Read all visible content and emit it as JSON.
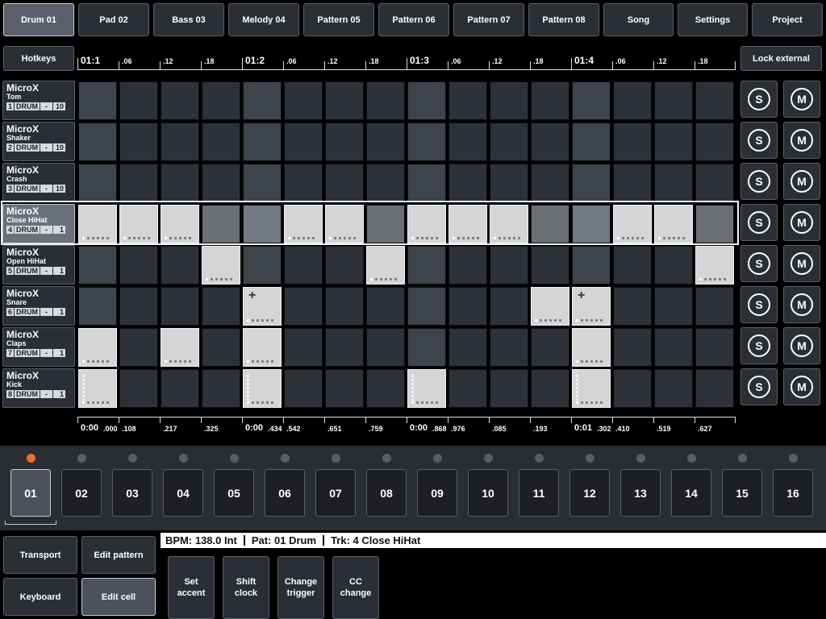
{
  "tabs": [
    {
      "label": "Drum 01",
      "active": true
    },
    {
      "label": "Pad 02",
      "active": false
    },
    {
      "label": "Bass 03",
      "active": false
    },
    {
      "label": "Melody 04",
      "active": false
    },
    {
      "label": "Pattern 05",
      "active": false
    },
    {
      "label": "Pattern 06",
      "active": false
    },
    {
      "label": "Pattern 07",
      "active": false
    },
    {
      "label": "Pattern 08",
      "active": false
    },
    {
      "label": "Song",
      "active": false
    },
    {
      "label": "Settings",
      "active": false
    },
    {
      "label": "Project",
      "active": false
    }
  ],
  "hotkeys_label": "Hotkeys",
  "lock_external_label": "Lock external",
  "ruler_top": [
    "01:1",
    ".06",
    ".12",
    ".18",
    "01:2",
    ".06",
    ".12",
    ".18",
    "01:3",
    ".06",
    ".12",
    ".18",
    "01:4",
    ".06",
    ".12",
    ".18"
  ],
  "ruler_bottom": [
    {
      "main": "0:00",
      "sub": ".000"
    },
    {
      "main": "",
      "sub": ".108"
    },
    {
      "main": "",
      "sub": ".217"
    },
    {
      "main": "",
      "sub": ".325"
    },
    {
      "main": "0:00",
      "sub": ".434"
    },
    {
      "main": "",
      "sub": ".542"
    },
    {
      "main": "",
      "sub": ".651"
    },
    {
      "main": "",
      "sub": ".759"
    },
    {
      "main": "0:00",
      "sub": ".868"
    },
    {
      "main": "",
      "sub": ".976"
    },
    {
      "main": "",
      "sub": ".085"
    },
    {
      "main": "",
      "sub": ".193"
    },
    {
      "main": "0:01",
      "sub": ".302"
    },
    {
      "main": "",
      "sub": ".410"
    },
    {
      "main": "",
      "sub": ".519"
    },
    {
      "main": "",
      "sub": ".627"
    }
  ],
  "tracks": [
    {
      "name": "MicroX",
      "instrument": "Tom",
      "num": "1",
      "type": "DRUM",
      "mode": "-",
      "note": "10",
      "selected": false,
      "cells": [
        0,
        0,
        0,
        0,
        0,
        0,
        0,
        0,
        0,
        0,
        0,
        0,
        0,
        0,
        0,
        0
      ]
    },
    {
      "name": "MicroX",
      "instrument": "Shaker",
      "num": "2",
      "type": "DRUM",
      "mode": "-",
      "note": "10",
      "selected": false,
      "cells": [
        0,
        0,
        0,
        0,
        0,
        0,
        0,
        0,
        0,
        0,
        0,
        0,
        0,
        0,
        0,
        0
      ]
    },
    {
      "name": "MicroX",
      "instrument": "Crash",
      "num": "3",
      "type": "DRUM",
      "mode": "-",
      "note": "10",
      "selected": false,
      "cells": [
        0,
        0,
        0,
        0,
        0,
        0,
        0,
        0,
        0,
        0,
        0,
        0,
        0,
        0,
        0,
        0
      ]
    },
    {
      "name": "MicroX",
      "instrument": "Close HiHat",
      "num": "4",
      "type": "DRUM",
      "mode": "-",
      "note": "1",
      "selected": true,
      "cells": [
        1,
        1,
        1,
        2,
        2,
        1,
        1,
        2,
        1,
        1,
        1,
        2,
        2,
        1,
        1,
        2
      ]
    },
    {
      "name": "MicroX",
      "instrument": "Open HiHat",
      "num": "5",
      "type": "DRUM",
      "mode": "-",
      "note": "1",
      "selected": false,
      "cells": [
        0,
        0,
        0,
        1,
        0,
        0,
        0,
        1,
        0,
        0,
        0,
        0,
        0,
        0,
        0,
        1
      ]
    },
    {
      "name": "MicroX",
      "instrument": "Snare",
      "num": "6",
      "type": "DRUM",
      "mode": "-",
      "note": "1",
      "selected": false,
      "cells": [
        0,
        0,
        0,
        0,
        3,
        0,
        0,
        0,
        0,
        0,
        0,
        1,
        3,
        0,
        0,
        0
      ]
    },
    {
      "name": "MicroX",
      "instrument": "Claps",
      "num": "7",
      "type": "DRUM",
      "mode": "-",
      "note": "1",
      "selected": false,
      "cells": [
        1,
        0,
        1,
        0,
        1,
        0,
        0,
        0,
        0,
        0,
        0,
        0,
        1,
        0,
        0,
        0
      ]
    },
    {
      "name": "MicroX",
      "instrument": "Kick",
      "num": "8",
      "type": "DRUM",
      "mode": "-",
      "note": "1",
      "selected": false,
      "cells": [
        4,
        0,
        0,
        0,
        4,
        0,
        0,
        0,
        4,
        0,
        0,
        0,
        4,
        0,
        0,
        0
      ]
    }
  ],
  "solo_label": "S",
  "mute_label": "M",
  "steps": [
    {
      "label": "01",
      "playing": true,
      "active": true
    },
    {
      "label": "02",
      "playing": false,
      "active": false
    },
    {
      "label": "03",
      "playing": false,
      "active": false
    },
    {
      "label": "04",
      "playing": false,
      "active": false
    },
    {
      "label": "05",
      "playing": false,
      "active": false
    },
    {
      "label": "06",
      "playing": false,
      "active": false
    },
    {
      "label": "07",
      "playing": false,
      "active": false
    },
    {
      "label": "08",
      "playing": false,
      "active": false
    },
    {
      "label": "09",
      "playing": false,
      "active": false
    },
    {
      "label": "10",
      "playing": false,
      "active": false
    },
    {
      "label": "11",
      "playing": false,
      "active": false
    },
    {
      "label": "12",
      "playing": false,
      "active": false
    },
    {
      "label": "13",
      "playing": false,
      "active": false
    },
    {
      "label": "14",
      "playing": false,
      "active": false
    },
    {
      "label": "15",
      "playing": false,
      "active": false
    },
    {
      "label": "16",
      "playing": false,
      "active": false
    }
  ],
  "modes": {
    "transport": "Transport",
    "edit_pattern": "Edit pattern",
    "keyboard": "Keyboard",
    "edit_cell": "Edit cell"
  },
  "status": {
    "bpm": "BPM: 138.0 Int",
    "pattern": "Pat: 01 Drum",
    "track": "Trk: 4 Close HiHat"
  },
  "actions": [
    {
      "line1": "Set",
      "line2": "accent"
    },
    {
      "line1": "Shift",
      "line2": "clock"
    },
    {
      "line1": "Change",
      "line2": "trigger"
    },
    {
      "line1": "CC",
      "line2": "change"
    }
  ],
  "colors": {
    "accent": "#f26b2c",
    "cell_on": "#d4d5d7",
    "cell_off": "#2e3238",
    "cell_beat": "#3e444c",
    "selection": "#f2f2f2"
  }
}
